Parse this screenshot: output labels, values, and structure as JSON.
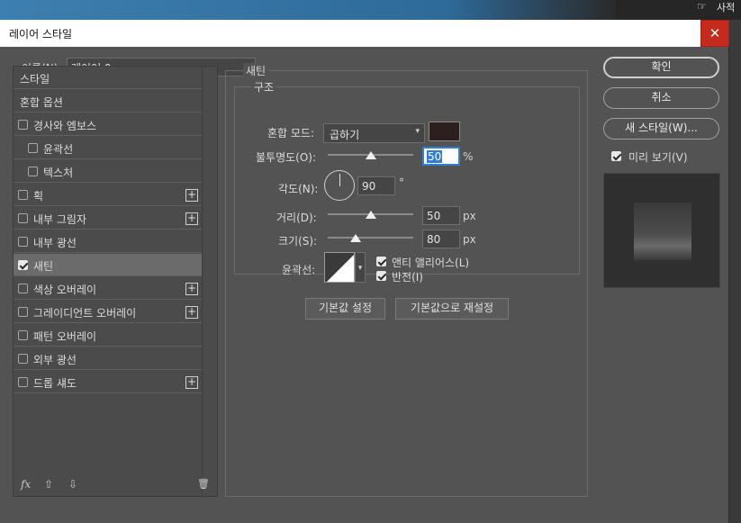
{
  "background": {
    "right_label": "사적"
  },
  "dialog": {
    "title": "레이어 스타일",
    "close_glyph": "✕",
    "name_label": "이름(N):",
    "name_value": "레이어 0"
  },
  "style_list": {
    "items": [
      {
        "label": "스타일",
        "checkbox": false,
        "plus": false
      },
      {
        "label": "혼합 옵션",
        "checkbox": false,
        "plus": false
      },
      {
        "label": "경사와 엠보스",
        "checkbox": true,
        "checked": false,
        "plus": false
      },
      {
        "label": "윤곽선",
        "checkbox": true,
        "checked": false,
        "plus": false,
        "indent": true
      },
      {
        "label": "텍스처",
        "checkbox": true,
        "checked": false,
        "plus": false,
        "indent": true
      },
      {
        "label": "획",
        "checkbox": true,
        "checked": false,
        "plus": true
      },
      {
        "label": "내부 그림자",
        "checkbox": true,
        "checked": false,
        "plus": true
      },
      {
        "label": "내부 광선",
        "checkbox": true,
        "checked": false,
        "plus": false
      },
      {
        "label": "새틴",
        "checkbox": true,
        "checked": true,
        "plus": false,
        "selected": true
      },
      {
        "label": "색상 오버레이",
        "checkbox": true,
        "checked": false,
        "plus": true
      },
      {
        "label": "그레이디언트 오버레이",
        "checkbox": true,
        "checked": false,
        "plus": true
      },
      {
        "label": "패턴 오버레이",
        "checkbox": true,
        "checked": false,
        "plus": false
      },
      {
        "label": "외부 광선",
        "checkbox": true,
        "checked": false,
        "plus": false
      },
      {
        "label": "드롭 섀도",
        "checkbox": true,
        "checked": false,
        "plus": true
      }
    ],
    "plus_glyph": "+",
    "bottom": {
      "fx": "fx",
      "up": "⇧",
      "down": "⇩",
      "trash": "🗑"
    }
  },
  "satin": {
    "section_title": "새틴",
    "structure_title": "구조",
    "blend_mode_label": "혼합 모드:",
    "blend_mode_value": "곱하기",
    "blend_color": "#2e1f1f",
    "opacity_label": "불투명도(O):",
    "opacity_value": "50",
    "opacity_unit": "%",
    "opacity_level": 0.5,
    "angle_label": "각도(N):",
    "angle_value": "90",
    "angle_unit": "°",
    "distance_label": "거리(D):",
    "distance_value": "50",
    "distance_unit": "px",
    "distance_level": 0.5,
    "size_label": "크기(S):",
    "size_value": "80",
    "size_unit": "px",
    "size_level": 0.33,
    "contour_label": "윤곽선:",
    "antialias_label": "앤티 앨리어스(L)",
    "antialias_checked": true,
    "invert_label": "반전(I)",
    "invert_checked": true,
    "default_set_label": "기본값 설정",
    "default_reset_label": "기본값으로 재설정"
  },
  "actions": {
    "ok_label": "확인",
    "cancel_label": "취소",
    "new_style_label": "새 스타일(W)...",
    "preview_label": "미리 보기(V)",
    "preview_checked": true
  }
}
